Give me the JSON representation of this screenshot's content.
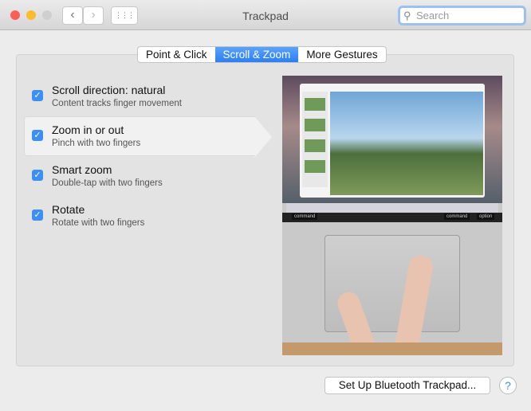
{
  "window": {
    "title": "Trackpad"
  },
  "toolbar": {
    "back": "‹",
    "forward": "›",
    "grid": "⋮⋮⋮",
    "search_placeholder": "Search"
  },
  "tabs": [
    {
      "label": "Point & Click"
    },
    {
      "label": "Scroll & Zoom",
      "active": true
    },
    {
      "label": "More Gestures"
    }
  ],
  "options": [
    {
      "label": "Scroll direction: natural",
      "description": "Content tracks finger movement",
      "checked": true
    },
    {
      "label": "Zoom in or out",
      "description": "Pinch with two fingers",
      "checked": true,
      "selected": true
    },
    {
      "label": "Smart zoom",
      "description": "Double-tap with two fingers",
      "checked": true
    },
    {
      "label": "Rotate",
      "description": "Rotate with two fingers",
      "checked": true
    }
  ],
  "preview": {
    "keys": [
      "command",
      "command",
      "option"
    ]
  },
  "footer": {
    "setup_button": "Set Up Bluetooth Trackpad...",
    "help": "?"
  },
  "colors": {
    "accent": "#3b8ff6"
  }
}
